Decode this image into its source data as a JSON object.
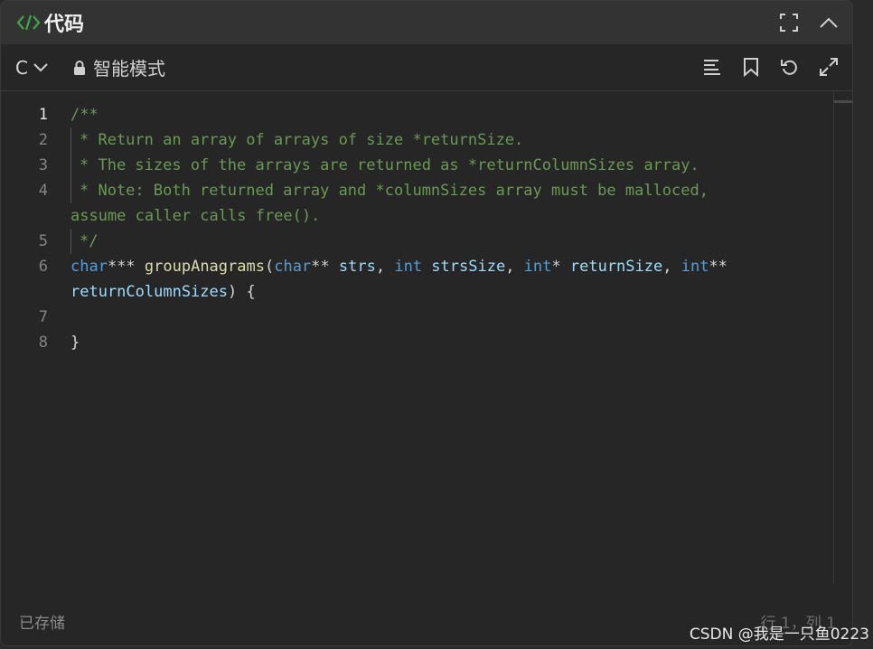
{
  "header": {
    "title": "代码",
    "code_icon": "code-icon",
    "fullscreen_icon": "fullscreen-icon",
    "collapse_icon": "chevron-up-icon"
  },
  "toolbar": {
    "language": "C",
    "mode_label": "智能模式",
    "mode_icon": "lock-icon",
    "tools": [
      "format-icon",
      "bookmark-icon",
      "reset-icon",
      "expand-icon"
    ]
  },
  "editor": {
    "lines": [
      {
        "number": "1",
        "text": "/**"
      },
      {
        "number": "2",
        "text": " * Return an array of arrays of size *returnSize."
      },
      {
        "number": "3",
        "text": " * The sizes of the arrays are returned as *returnColumnSizes array."
      },
      {
        "number": "4",
        "text": " * Note: Both returned array and *columnSizes array must be malloced,",
        "cont": "assume caller calls free()."
      },
      {
        "number": "5",
        "text": " */"
      },
      {
        "number": "6",
        "text": "char*** groupAnagrams(char** strs, int strsSize, int* returnSize, int**",
        "cont": "returnColumnSizes) {"
      },
      {
        "number": "7",
        "text": ""
      },
      {
        "number": "8",
        "text": "}"
      }
    ],
    "tokens": {
      "l1": "/**",
      "l2": "* Return an array of arrays of size *returnSize.",
      "l3": "* The sizes of the arrays are returned as *returnColumnSizes array.",
      "l4": "* Note: Both returned array and *columnSizes array must be malloced,",
      "l4b": "assume caller calls free().",
      "l5": "*/",
      "kw_char": "char",
      "stars3": "*** ",
      "fn": "groupAnagrams",
      "lp": "(",
      "stars2": "** ",
      "strs": "strs",
      "comma": ", ",
      "kw_int": "int",
      "sp": " ",
      "strsSize": "strsSize",
      "star1": "* ",
      "returnSize": "returnSize",
      "stars2b": "**",
      "returnColumnSizes": "returnColumnSizes",
      "rp": ") {",
      "close": "}"
    }
  },
  "status": {
    "saved": "已存储",
    "position": "行 1，列 1"
  },
  "watermark": "CSDN @我是一只鱼0223",
  "colors": {
    "comment": "#6a9955",
    "keyword": "#569cd6",
    "function": "#dcdcaa",
    "variable": "#9cdcfe",
    "icon_green": "#3fa64a"
  }
}
